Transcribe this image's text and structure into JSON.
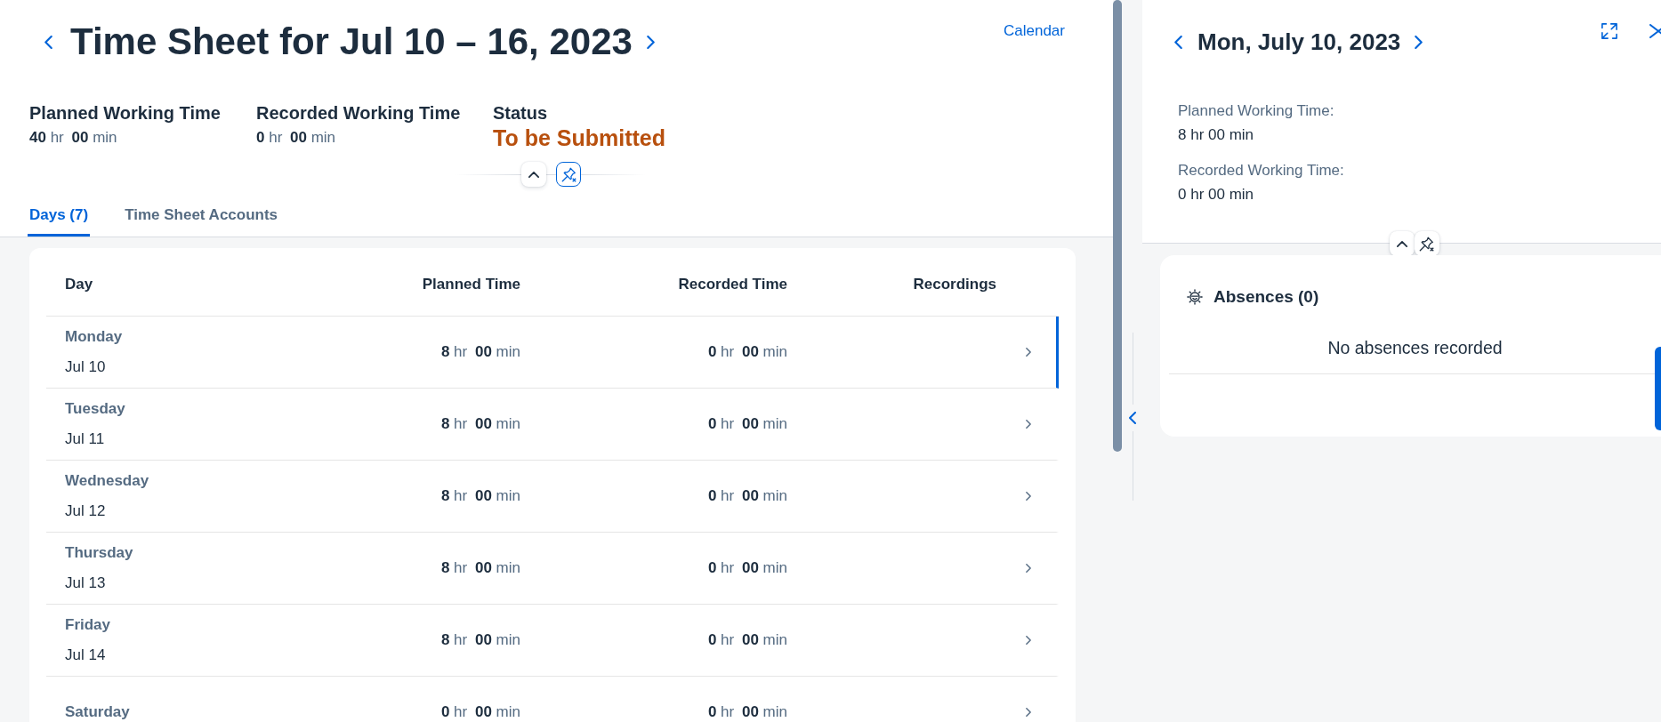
{
  "timesheet": {
    "title": "Time Sheet for Jul 10 – 16, 2023",
    "calendar_link": "Calendar",
    "attributes": [
      {
        "kind": "duration",
        "label": "Planned Working Time",
        "value": "**40** hr **00** min"
      },
      {
        "kind": "duration",
        "label": "Recorded Working Time",
        "value": "**0** hr **00** min"
      },
      {
        "kind": "status",
        "label": "Status",
        "value": "To be Submitted"
      }
    ],
    "header_controls": {
      "pin_highlighted": true
    },
    "tabs": [
      {
        "label": "Days (7)",
        "selected": true
      },
      {
        "label": "Time Sheet Accounts",
        "selected": false
      }
    ],
    "table": {
      "columns": [
        "Day",
        "Planned Time",
        "Recorded Time",
        "Recordings"
      ],
      "rows": [
        {
          "day": "Monday",
          "date": "Jul 10",
          "planned": "**8** hr **00** min",
          "recorded": "**0** hr **00** min",
          "selected": true
        },
        {
          "day": "Tuesday",
          "date": "Jul 11",
          "planned": "**8** hr **00** min",
          "recorded": "**0** hr **00** min",
          "selected": false
        },
        {
          "day": "Wednesday",
          "date": "Jul 12",
          "planned": "**8** hr **00** min",
          "recorded": "**0** hr **00** min",
          "selected": false
        },
        {
          "day": "Thursday",
          "date": "Jul 13",
          "planned": "**8** hr **00** min",
          "recorded": "**0** hr **00** min",
          "selected": false
        },
        {
          "day": "Friday",
          "date": "Jul 14",
          "planned": "**8** hr **00** min",
          "recorded": "**0** hr **00** min",
          "selected": false
        },
        {
          "day": "Saturday",
          "planned": "**0** hr **00** min",
          "recorded": "**0** hr **00** min",
          "selected": false
        }
      ]
    }
  },
  "day_detail": {
    "title": "Mon, July 10, 2023",
    "fields": [
      {
        "label": "Planned Working Time:",
        "value": "8 hr 00 min"
      },
      {
        "label": "Recorded Working Time:",
        "value": "0 hr 00 min"
      }
    ],
    "header_controls": {
      "pin_highlighted": false
    },
    "absences": {
      "title": "Absences (0)",
      "empty_text": "No absences recorded"
    }
  }
}
